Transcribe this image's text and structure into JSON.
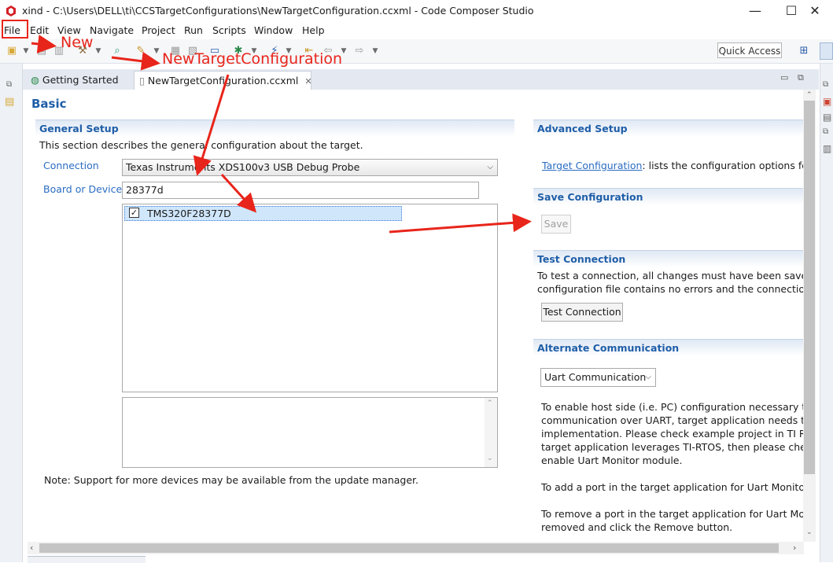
{
  "window": {
    "title": "xind - C:\\Users\\DELL\\ti\\CCSTargetConfigurations\\NewTargetConfiguration.ccxml - Code Composer Studio",
    "minimize": "—",
    "maximize": "☐",
    "close": "✕"
  },
  "menu": [
    "File",
    "Edit",
    "View",
    "Navigate",
    "Project",
    "Run",
    "Scripts",
    "Window",
    "Help"
  ],
  "toolbar": {
    "quick_access": "Quick Access"
  },
  "tabs": [
    {
      "label": "Getting Started",
      "icon": "globe-icon"
    },
    {
      "label": "NewTargetConfiguration.ccxml",
      "icon": "file-icon",
      "close": "✕"
    }
  ],
  "editor": {
    "page_title": "Basic",
    "general_setup": {
      "heading": "General Setup",
      "description": "This section describes the general configuration about the target.",
      "connection_label": "Connection",
      "connection_value": "Texas Instruments XDS100v3 USB Debug Probe",
      "board_label": "Board or Device",
      "board_value": "28377d",
      "devices": [
        {
          "label": "TMS320F28377D",
          "checked": true
        }
      ],
      "note": "Note: Support for more devices may be available from the update manager."
    },
    "advanced_setup": {
      "heading": "Advanced Setup",
      "link": "Target Configuration",
      "text": ": lists the configuration options for t"
    },
    "save_configuration": {
      "heading": "Save Configuration",
      "save_label": "Save"
    },
    "test_connection": {
      "heading": "Test Connection",
      "line1": "To test a connection, all changes must have been saved, th",
      "line2": "configuration file contains no errors and the connection ty",
      "button": "Test Connection"
    },
    "alternate_communication": {
      "heading": "Alternate Communication",
      "select_value": "Uart Communication",
      "para1": [
        "To enable host side (i.e. PC) configuration necessary to fa",
        "communication over UART, target application needs to in",
        "implementation. Please check example project in TI Reso",
        "target application leverages TI-RTOS, then please check c",
        "enable Uart Monitor module."
      ],
      "para2": "To add a port in the target application for Uart Monitor,",
      "para3": [
        "To remove a port in the target application for Uart Monit",
        "removed and click the Remove button."
      ]
    }
  },
  "annotations": {
    "new": "New",
    "new_target": "NewTargetConfiguration",
    "color": "#e8251b"
  },
  "colors": {
    "section_heading": "#1f5ea8",
    "link": "#2b6cc2",
    "selection": "#cfe6fb"
  }
}
